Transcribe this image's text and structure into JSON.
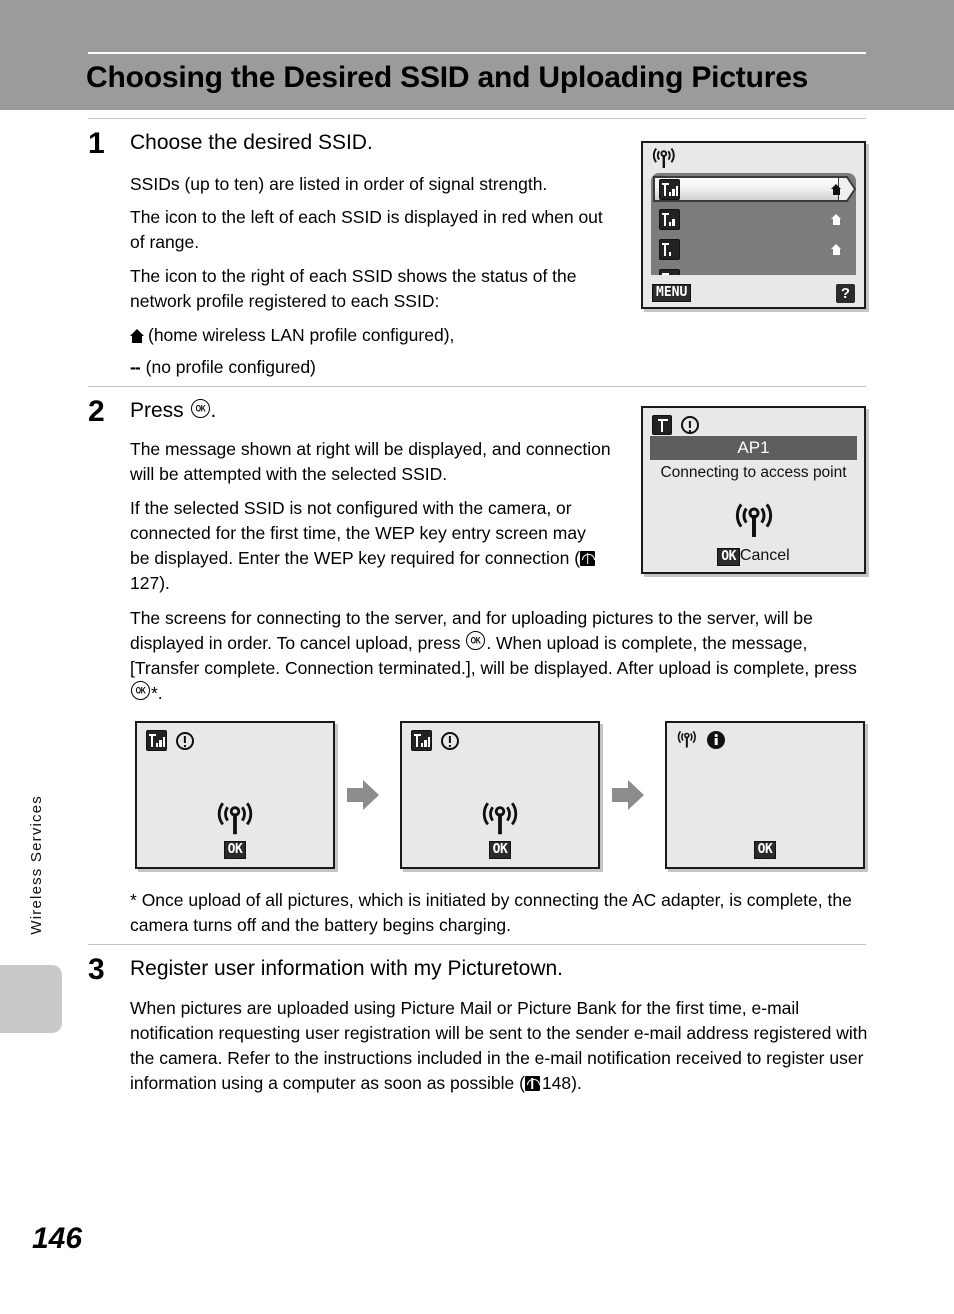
{
  "header": {
    "title": "Choosing the Desired SSID and Uploading Pictures"
  },
  "sidebar": {
    "section_label": "Wireless Services"
  },
  "page_number": "146",
  "steps": [
    {
      "number": "1",
      "title": "Choose the desired SSID.",
      "paragraphs": [
        "SSIDs (up to ten) are listed in order of signal strength.",
        "The icon to the left of each SSID is displayed in red when out of range.",
        "The icon to the right of each SSID shows the status of the network profile registered to each SSID:"
      ],
      "legend": [
        {
          "icon": "home-icon",
          "text": "(home wireless LAN profile configured),"
        },
        {
          "icon": "dashes",
          "text": "(no profile configured)"
        }
      ]
    },
    {
      "number": "2",
      "title_prefix": "Press ",
      "title_suffix": ".",
      "title_icon": "ok-button-icon",
      "paragraphs": [
        "The message shown at right will be displayed, and connection will be attempted with the selected SSID.",
        "If the selected SSID is not configured with the camera, or connected for the first time, the WEP key entry screen may be displayed. Enter the WEP key required for connection (",
        "The screens for connecting to the server, and for uploading pictures to the server, will be displayed in order. To cancel upload, press "
      ],
      "ref_page_1": "127",
      "body_continued_a": ". When upload is complete, the message, [Transfer complete. Connection terminated.], will be displayed. After upload is complete, press ",
      "body_continued_b": "*."
    },
    {
      "number": "3",
      "title": "Register user information with my Picturetown.",
      "paragraph_a": "When pictures are uploaded using Picture Mail or Picture Bank for the first time, e-mail notification requesting user registration will be sent to the sender e-mail address registered with the camera. Refer to the instructions included in the e-mail notification received to register user information using a computer as soon as possible (",
      "ref_page": "148",
      "paragraph_b": ")."
    }
  ],
  "footnote": {
    "marker": "*",
    "text": "Once upload of all pictures, which is initiated by connecting the AC adapter, is complete, the camera turns off and the battery begins charging."
  },
  "ssid_screen": {
    "name": "ssid-list-screen",
    "header_icon": "wireless-antenna-icon",
    "rows": [
      {
        "signal_icon": "signal-strength-3-icon",
        "profile_icon": "home-icon",
        "selected": true
      },
      {
        "signal_icon": "signal-strength-2-icon",
        "profile_icon": "home-icon",
        "selected": false
      },
      {
        "signal_icon": "signal-strength-1-icon",
        "profile_icon": "home-icon",
        "selected": false
      },
      {
        "signal_icon": "signal-strength-1-icon",
        "profile_icon": "dashes-icon",
        "selected": false
      }
    ],
    "menu_label": "MENU",
    "help_label": "?"
  },
  "connect_screen": {
    "name": "connecting-screen",
    "status_icon": "antenna-box-icon",
    "alert_icon": "warning-icon",
    "title": "AP1",
    "message": "Connecting to access point",
    "center_icon": "wireless-antenna-icon",
    "cancel_badge": "OK",
    "cancel_label": "Cancel"
  },
  "flow_screens": [
    {
      "name": "connecting-to-server-screen",
      "status_icon": "signal-strength-3-icon",
      "alert_icon": "warning-icon",
      "center_icon": "wireless-antenna-icon",
      "ok_badge": "OK"
    },
    {
      "name": "uploading-screen",
      "status_icon": "signal-strength-3-icon",
      "alert_icon": "warning-icon",
      "center_icon": "wireless-antenna-icon",
      "ok_badge": "OK"
    },
    {
      "name": "transfer-complete-screen",
      "status_icon": "wireless-antenna-icon",
      "alert_icon": "info-icon",
      "center_icon": "",
      "ok_badge": "OK"
    }
  ],
  "flow_arrows": [
    {
      "name": "flow-arrow-1"
    },
    {
      "name": "flow-arrow-2"
    }
  ],
  "colors": {
    "header_band": "#9b9b9b",
    "screen_bg": "#e8e8e8",
    "list_bg": "#7c7c7c",
    "title_bar": "#5e5e5e",
    "arrow": "#8c8c8c",
    "rule": "#c2c2c2"
  }
}
